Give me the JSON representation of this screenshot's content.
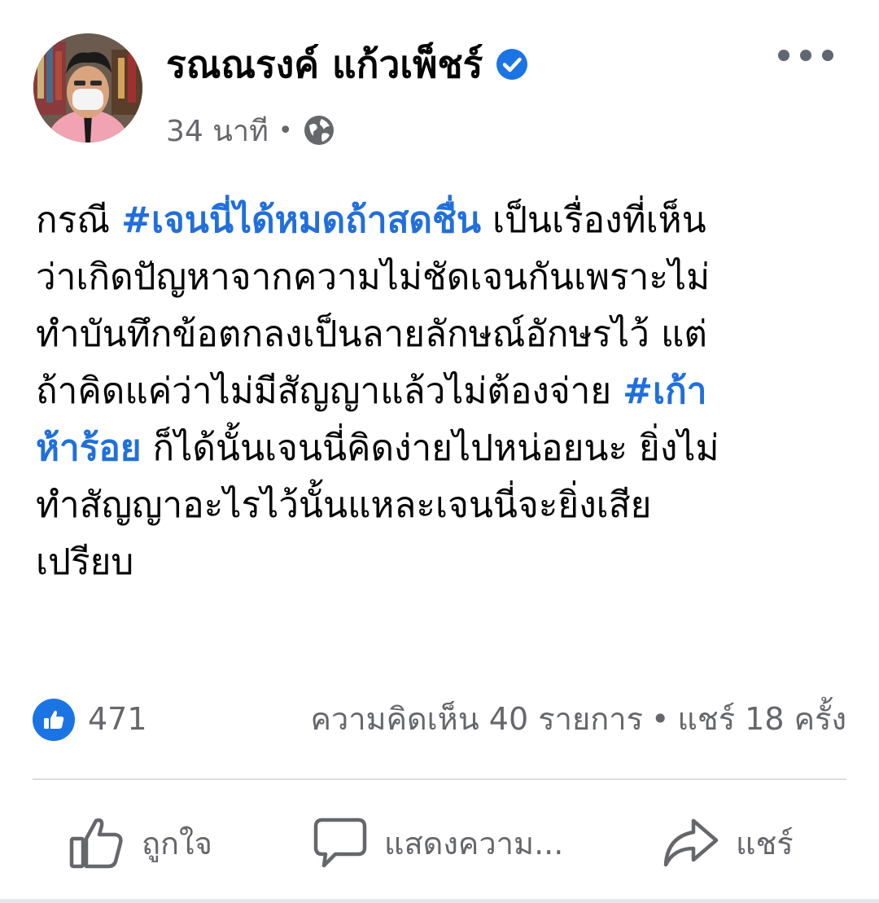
{
  "post": {
    "author": "รณณรงค์ แก้วเพ็ชร์",
    "time": "34 นาที",
    "separator": "•",
    "lines": [
      [
        {
          "t": "กรณี "
        },
        {
          "t": "#เจนนี่ได้หมดถ้าสดชื่น",
          "tag": true
        },
        {
          "t": " เป็นเรื่องที่เห็น"
        }
      ],
      [
        {
          "t": "ว่าเกิดปัญหาจากความไม่ชัดเจนกันเพราะไม่"
        }
      ],
      [
        {
          "t": "ทำบันทึกข้อตกลงเป็นลายลักษณ์อักษรไว้ แต่"
        }
      ],
      [
        {
          "t": "ถ้าคิดแค่ว่าไม่มีสัญญาแล้วไม่ต้องจ่าย "
        },
        {
          "t": "#เก้า",
          "tag": true
        }
      ],
      [
        {
          "t": "ห้าร้อย",
          "tag": true
        },
        {
          "t": " ก็ได้นั้นเจนนี่คิดง่ายไปหน่อยนะ ยิ่งไม่"
        }
      ],
      [
        {
          "t": "ทำสัญญาอะไรไว้นั้นแหละเจนนี่จะยิ่งเสีย"
        }
      ],
      [
        {
          "t": "เปรียบ"
        }
      ]
    ]
  },
  "counts": {
    "likes": "471",
    "comments": "ความคิดเห็น 40 รายการ",
    "dot": "•",
    "shares": "แชร์ 18 ครั้ง"
  },
  "actions": {
    "like": "ถูกใจ",
    "comment": "แสดงความ...",
    "share": "แชร์"
  },
  "icons": {
    "verified": "verified-badge-icon",
    "globe": "globe-icon",
    "more": "more-options-icon",
    "like_reaction": "thumbs-up-icon"
  },
  "colors": {
    "hashtag": "#216fdb",
    "verified": "#1b74e4",
    "secondary_text": "#65676b"
  }
}
